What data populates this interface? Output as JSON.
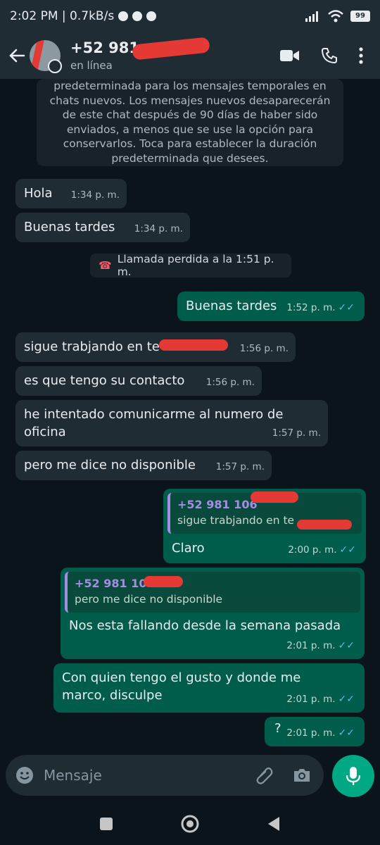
{
  "status_bar": {
    "time": "2:02 PM",
    "speed": "0.7kB/s",
    "battery": "99"
  },
  "header": {
    "contact_name": "+52 981",
    "contact_status": "en línea"
  },
  "system_message": {
    "lines": [
      "predeterminada para los mensajes temporales en",
      "chats nuevos. Los mensajes nuevos desaparecerán",
      "de este chat después de 90 días de haber sido",
      "enviados, a menos que se use la opción para",
      "conservarlos. Toca para establecer la duración",
      "predeterminada que desees."
    ]
  },
  "missed_call": "Llamada perdida a la 1:51 p. m.",
  "messages": [
    {
      "text": "Hola",
      "time": "1:34 p. m."
    },
    {
      "text": "Buenas tardes",
      "time": "1:34 p. m."
    },
    {
      "text": "Buenas tardes",
      "time": "1:52 p. m."
    },
    {
      "text": "sigue trabjando en te",
      "time": "1:56 p. m."
    },
    {
      "text": "es que tengo su contacto",
      "time": "1:56 p. m."
    },
    {
      "text": "he intentado comunicarme al numero de oficina",
      "time": "1:57 p. m."
    },
    {
      "text": "pero me dice no disponible",
      "time": "1:57 p. m."
    },
    {
      "text": "Claro",
      "time": "2:00 p. m.",
      "quote_name": "+52 981 106",
      "quote_text": "sigue trabjando en te"
    },
    {
      "text": "Nos esta fallando desde la semana pasada",
      "time": "2:01 p. m.",
      "quote_name": "+52 981 106",
      "quote_text": "pero me dice no disponible"
    },
    {
      "text": "Con quien tengo el gusto y donde me marco, disculpe",
      "time": "2:01 p. m."
    },
    {
      "text": "?",
      "time": "2:01 p. m."
    }
  ],
  "input": {
    "placeholder": "Mensaje"
  },
  "colors": {
    "incoming_bubble": "#202c33",
    "outgoing_bubble": "#005c4b",
    "accent": "#00a884",
    "read_ticks": "#53bdeb"
  }
}
